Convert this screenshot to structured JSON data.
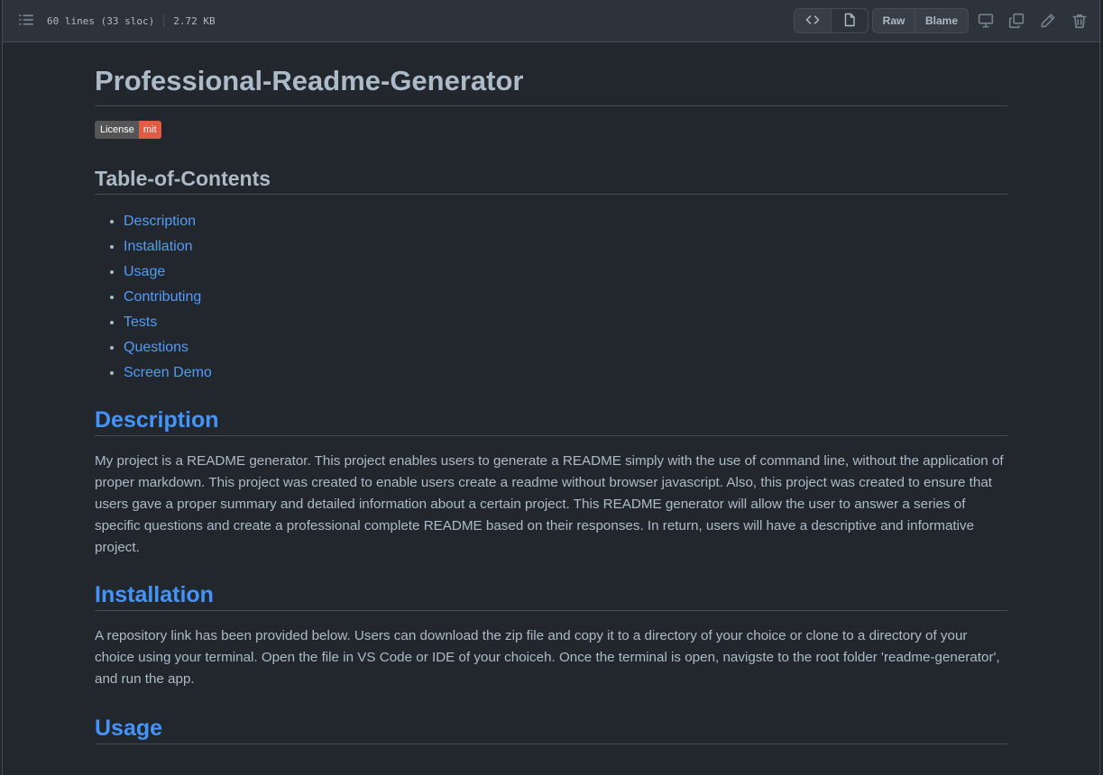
{
  "toolbar": {
    "file_lines": "60 lines (33 sloc)",
    "file_size": "2.72 KB",
    "raw_label": "Raw",
    "blame_label": "Blame"
  },
  "icons": {
    "list": "list-unordered-icon",
    "code": "code-icon",
    "preview": "file-icon",
    "desktop": "desktop-icon",
    "copy": "copy-icon",
    "edit": "pencil-icon",
    "delete": "trash-icon"
  },
  "colors": {
    "link": "#539bf5",
    "section_heading": "#4493f8",
    "badge_label_bg": "#555555",
    "badge_value_bg": "#e05d44"
  },
  "readme": {
    "title": "Professional-Readme-Generator",
    "badge": {
      "label": "License",
      "value": "mit"
    },
    "toc_title": "Table-of-Contents",
    "toc": [
      "Description",
      "Installation",
      "Usage",
      "Contributing",
      "Tests",
      "Questions",
      "Screen Demo"
    ],
    "description": {
      "heading": "Description",
      "text": "My project is a README generator. This project enables users to generate a README simply with the use of command line, without the application of proper markdown. This project was created to enable users create a readme without browser javascript. Also, this project was created to ensure that users gave a proper summary and detailed information about a certain project. This README generator will allow the user to answer a series of specific questions and create a professional complete README based on their responses. In return, users will have a descriptive and informative project."
    },
    "installation": {
      "heading": "Installation",
      "text": "A repository link has been provided below. Users can download the zip file and copy it to a directory of your choice or clone to a directory of your choice using your terminal. Open the file in VS Code or IDE of your choiceh. Once the terminal is open, navigste to the root folder 'readme-generator', and run the app."
    },
    "usage": {
      "heading": "Usage"
    }
  }
}
